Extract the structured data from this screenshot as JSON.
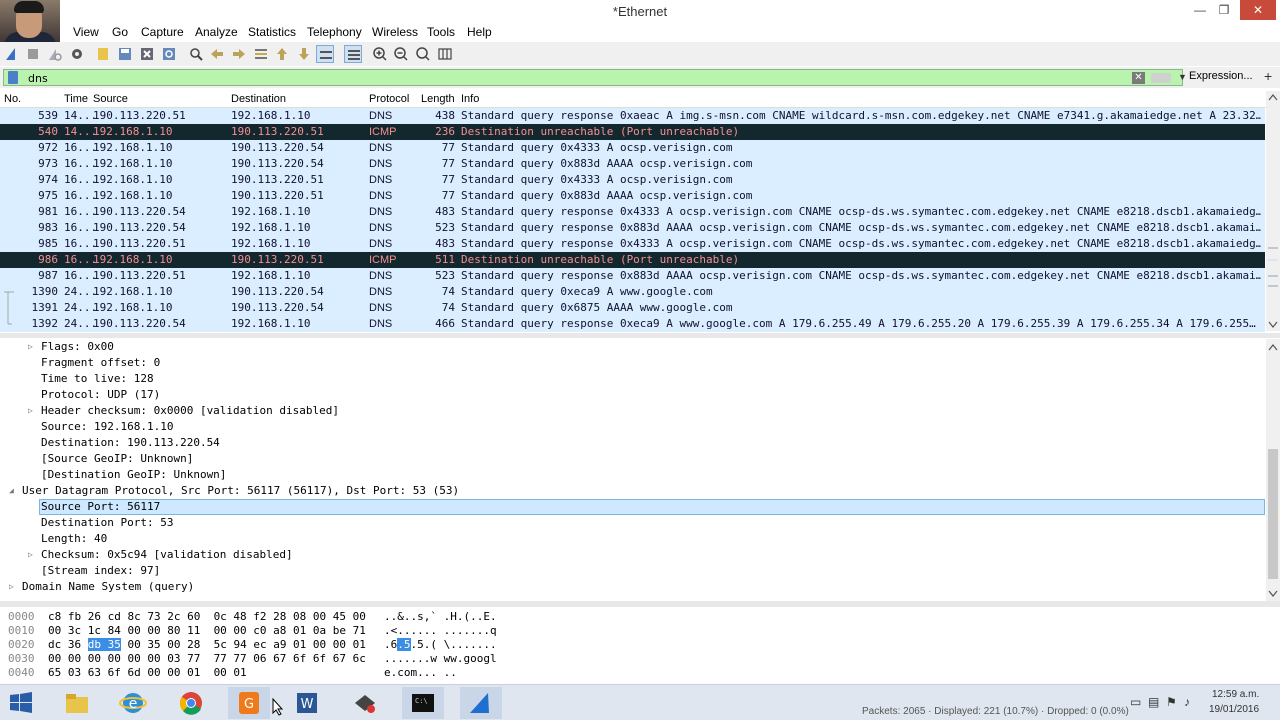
{
  "window": {
    "title": "*Ethernet",
    "min_glyph": "—",
    "max_glyph": "❐",
    "close_glyph": "✕"
  },
  "menu": [
    "View",
    "Go",
    "Capture",
    "Analyze",
    "Statistics",
    "Telephony",
    "Wireless",
    "Tools",
    "Help"
  ],
  "toolbar_icons": [
    "shark-fin-start-icon",
    "stop-icon",
    "restart-icon",
    "options-gear-icon",
    "open-folder-icon",
    "save-icon",
    "close-file-icon",
    "reload-icon",
    "find-icon",
    "back-arrow-icon",
    "forward-arrow-icon",
    "go-to-packet-icon",
    "first-packet-icon",
    "last-packet-icon",
    "autoscroll-icon",
    "colorize-icon",
    "zoom-in-icon",
    "zoom-out-icon",
    "normal-size-icon",
    "resize-columns-icon"
  ],
  "filter": {
    "value": "dns",
    "expression_label": "Expression...",
    "plus_label": "+",
    "clear_glyph": "✕",
    "dropdown_glyph": "▼"
  },
  "columns": {
    "no": "No.",
    "time": "Time",
    "source": "Source",
    "destination": "Destination",
    "protocol": "Protocol",
    "length": "Length",
    "info": "Info"
  },
  "packets": [
    {
      "no": "539",
      "time": "14...",
      "src": "190.113.220.51",
      "dst": "192.168.1.10",
      "proto": "DNS",
      "len": "438",
      "info": "Standard query response 0xaeac A img.s-msn.com CNAME wildcard.s-msn.com.edgekey.net CNAME e7341.g.akamaiedge.net A 23.32…"
    },
    {
      "no": "540",
      "time": "14...",
      "src": "192.168.1.10",
      "dst": "190.113.220.51",
      "proto": "ICMP",
      "len": "236",
      "info": "Destination unreachable (Port unreachable)"
    },
    {
      "no": "972",
      "time": "16...",
      "src": "192.168.1.10",
      "dst": "190.113.220.54",
      "proto": "DNS",
      "len": "77",
      "info": "Standard query 0x4333 A ocsp.verisign.com"
    },
    {
      "no": "973",
      "time": "16...",
      "src": "192.168.1.10",
      "dst": "190.113.220.54",
      "proto": "DNS",
      "len": "77",
      "info": "Standard query 0x883d AAAA ocsp.verisign.com"
    },
    {
      "no": "974",
      "time": "16...",
      "src": "192.168.1.10",
      "dst": "190.113.220.51",
      "proto": "DNS",
      "len": "77",
      "info": "Standard query 0x4333 A ocsp.verisign.com"
    },
    {
      "no": "975",
      "time": "16...",
      "src": "192.168.1.10",
      "dst": "190.113.220.51",
      "proto": "DNS",
      "len": "77",
      "info": "Standard query 0x883d AAAA ocsp.verisign.com"
    },
    {
      "no": "981",
      "time": "16...",
      "src": "190.113.220.54",
      "dst": "192.168.1.10",
      "proto": "DNS",
      "len": "483",
      "info": "Standard query response 0x4333 A ocsp.verisign.com CNAME ocsp-ds.ws.symantec.com.edgekey.net CNAME e8218.dscb1.akamaiedg…"
    },
    {
      "no": "983",
      "time": "16...",
      "src": "190.113.220.54",
      "dst": "192.168.1.10",
      "proto": "DNS",
      "len": "523",
      "info": "Standard query response 0x883d AAAA ocsp.verisign.com CNAME ocsp-ds.ws.symantec.com.edgekey.net CNAME e8218.dscb1.akamai…"
    },
    {
      "no": "985",
      "time": "16...",
      "src": "190.113.220.51",
      "dst": "192.168.1.10",
      "proto": "DNS",
      "len": "483",
      "info": "Standard query response 0x4333 A ocsp.verisign.com CNAME ocsp-ds.ws.symantec.com.edgekey.net CNAME e8218.dscb1.akamaiedg…"
    },
    {
      "no": "986",
      "time": "16...",
      "src": "192.168.1.10",
      "dst": "190.113.220.51",
      "proto": "ICMP",
      "len": "511",
      "info": "Destination unreachable (Port unreachable)"
    },
    {
      "no": "987",
      "time": "16...",
      "src": "190.113.220.51",
      "dst": "192.168.1.10",
      "proto": "DNS",
      "len": "523",
      "info": "Standard query response 0x883d AAAA ocsp.verisign.com CNAME ocsp-ds.ws.symantec.com.edgekey.net CNAME e8218.dscb1.akamai…"
    },
    {
      "no": "1390",
      "time": "24...",
      "src": "192.168.1.10",
      "dst": "190.113.220.54",
      "proto": "DNS",
      "len": "74",
      "info": "Standard query 0xeca9 A www.google.com"
    },
    {
      "no": "1391",
      "time": "24...",
      "src": "192.168.1.10",
      "dst": "190.113.220.54",
      "proto": "DNS",
      "len": "74",
      "info": "Standard query 0x6875 AAAA www.google.com"
    },
    {
      "no": "1392",
      "time": "24...",
      "src": "190.113.220.54",
      "dst": "192.168.1.10",
      "proto": "DNS",
      "len": "466",
      "info": "Standard query response 0xeca9 A www.google.com A 179.6.255.49 A 179.6.255.20 A 179.6.255.39 A 179.6.255.34 A 179.6.255…"
    }
  ],
  "details": [
    {
      "text": "Flags: 0x00",
      "indent": 1,
      "arrow": "▷"
    },
    {
      "text": "Fragment offset: 0",
      "indent": 1,
      "arrow": ""
    },
    {
      "text": "Time to live: 128",
      "indent": 1,
      "arrow": ""
    },
    {
      "text": "Protocol: UDP (17)",
      "indent": 1,
      "arrow": ""
    },
    {
      "text": "Header checksum: 0x0000 [validation disabled]",
      "indent": 1,
      "arrow": "▷"
    },
    {
      "text": "Source: 192.168.1.10",
      "indent": 1,
      "arrow": ""
    },
    {
      "text": "Destination: 190.113.220.54",
      "indent": 1,
      "arrow": ""
    },
    {
      "text": "[Source GeoIP: Unknown]",
      "indent": 1,
      "arrow": ""
    },
    {
      "text": "[Destination GeoIP: Unknown]",
      "indent": 1,
      "arrow": ""
    },
    {
      "text": "User Datagram Protocol, Src Port: 56117 (56117), Dst Port: 53 (53)",
      "indent": 0,
      "arrow": "◢"
    },
    {
      "text": "Source Port: 56117",
      "indent": 1,
      "arrow": "",
      "selected": true
    },
    {
      "text": "Destination Port: 53",
      "indent": 1,
      "arrow": ""
    },
    {
      "text": "Length: 40",
      "indent": 1,
      "arrow": ""
    },
    {
      "text": "Checksum: 0x5c94 [validation disabled]",
      "indent": 1,
      "arrow": "▷"
    },
    {
      "text": "[Stream index: 97]",
      "indent": 1,
      "arrow": ""
    },
    {
      "text": "Domain Name System (query)",
      "indent": 0,
      "arrow": "▷"
    }
  ],
  "hex": [
    {
      "offset": "0000",
      "pre": "c8 fb 26 cd 8c 73 2c 60  0c 48 f2 28 08 00 45 00",
      "hl": "",
      "post": "",
      "a_pre": "..&..s,` .H.(..E.",
      "a_hl": "",
      "a_post": ""
    },
    {
      "offset": "0010",
      "pre": "00 3c 1c 84 00 00 80 11  00 00 c0 a8 01 0a be 71",
      "hl": "",
      "post": "",
      "a_pre": ".<...... .......q",
      "a_hl": "",
      "a_post": ""
    },
    {
      "offset": "0020",
      "pre": "dc 36 ",
      "hl": "db 35",
      "post": " 00 35 00 28  5c 94 ec a9 01 00 00 01",
      "a_pre": ".6",
      "a_hl": ".5",
      "a_post": ".5.( \\......."
    },
    {
      "offset": "0030",
      "pre": "00 00 00 00 00 00 03 77  77 77 06 67 6f 6f 67 6c",
      "hl": "",
      "post": "",
      "a_pre": ".......w ww.googl",
      "a_hl": "",
      "a_post": ""
    },
    {
      "offset": "0040",
      "pre": "65 03 63 6f 6d 00 00 01  00 01",
      "hl": "",
      "post": "",
      "a_pre": "e.com... ..",
      "a_hl": "",
      "a_post": ""
    }
  ],
  "status": {
    "packets_text": "Packets: 2065 · Displayed: 221 (10.7%) · Dropped: 0 (0.0%)",
    "clock_time": "12:59 a.m.",
    "clock_date": "19/01/2016"
  },
  "taskbar_apps": [
    "windows-start-icon",
    "file-explorer-icon",
    "internet-explorer-icon",
    "chrome-icon",
    "pdf-creator-icon",
    "word-icon",
    "app-icon",
    "cmd-icon",
    "wireshark-icon"
  ],
  "colors": {
    "udp_row_bg": "#daeeff",
    "icmp_row_bg": "#12272e",
    "icmp_row_fg": "#f78f8f",
    "filter_valid_bg": "#b9f3ae"
  }
}
